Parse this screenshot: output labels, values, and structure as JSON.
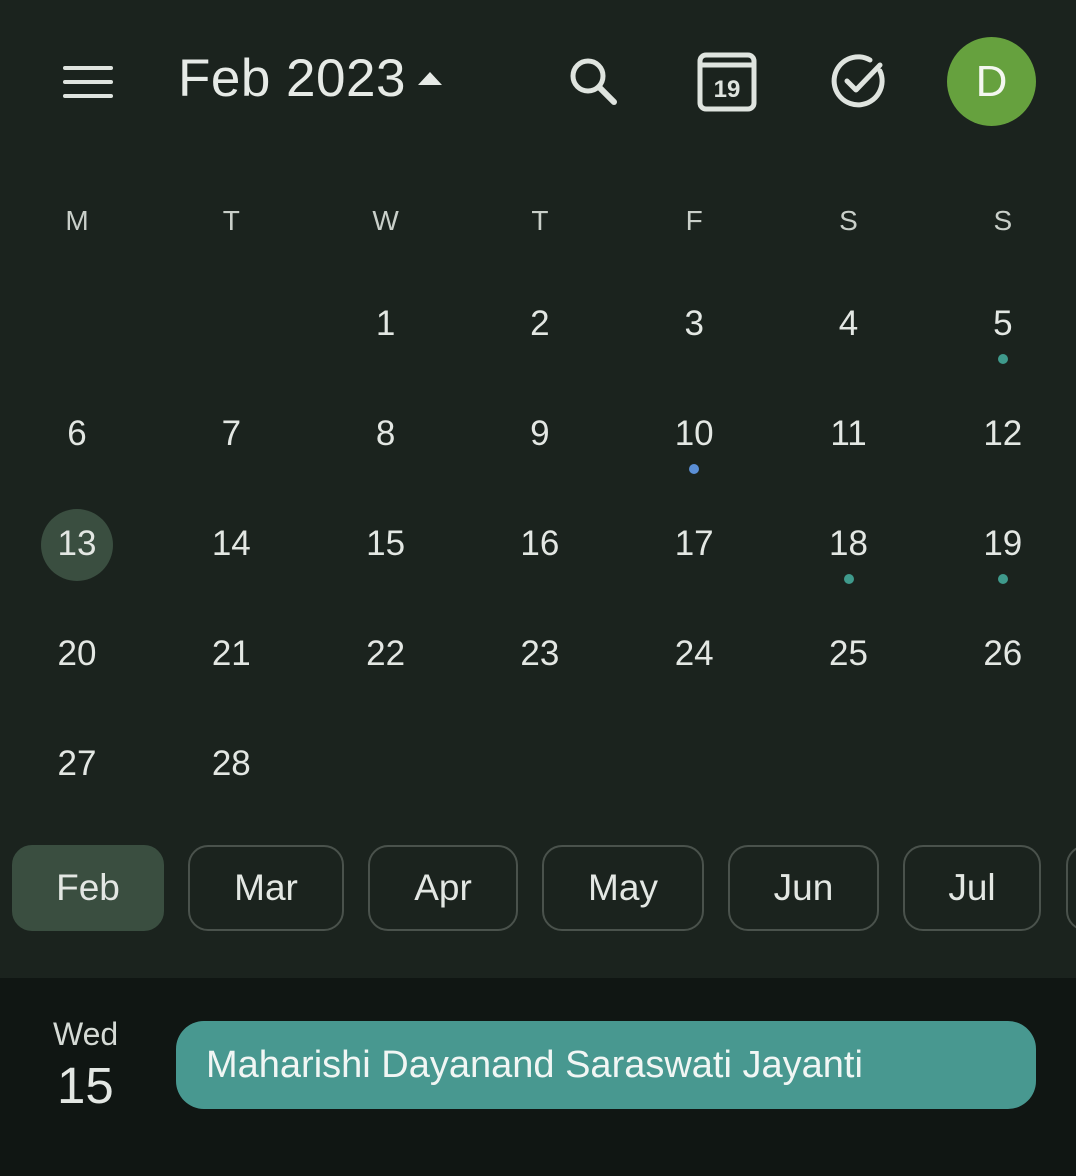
{
  "app_bar": {
    "title": "Feb 2023",
    "goto_today_label": "19",
    "avatar_initial": "D"
  },
  "colors": {
    "background": "#1b231e",
    "selected_accent": "#3a4e40",
    "avatar": "#66a13e",
    "event_teal": "#489890",
    "dot_teal": "#3f9a8c",
    "dot_blue": "#5b8fd6"
  },
  "weekdays": [
    "M",
    "T",
    "W",
    "T",
    "F",
    "S",
    "S"
  ],
  "calendar": {
    "selected_day": "15",
    "weeks": [
      [
        "",
        "",
        "1",
        "2",
        "3",
        "4",
        "5"
      ],
      [
        "6",
        "7",
        "8",
        "9",
        "10",
        "11",
        "12"
      ],
      [
        "13",
        "14",
        "15",
        "16",
        "17",
        "18",
        "19"
      ],
      [
        "20",
        "21",
        "22",
        "23",
        "24",
        "25",
        "26"
      ],
      [
        "27",
        "28",
        "",
        "",
        "",
        "",
        ""
      ]
    ],
    "event_dots": [
      {
        "day": "5",
        "color": "teal"
      },
      {
        "day": "10",
        "color": "blue"
      },
      {
        "day": "18",
        "color": "teal"
      },
      {
        "day": "19",
        "color": "teal"
      }
    ]
  },
  "month_chips": [
    "Feb",
    "Mar",
    "Apr",
    "May",
    "Jun",
    "Jul"
  ],
  "agenda": {
    "day_of_week": "Wed",
    "day_number": "15",
    "events": [
      "Maharishi Dayanand Saraswati Jayanti"
    ]
  }
}
